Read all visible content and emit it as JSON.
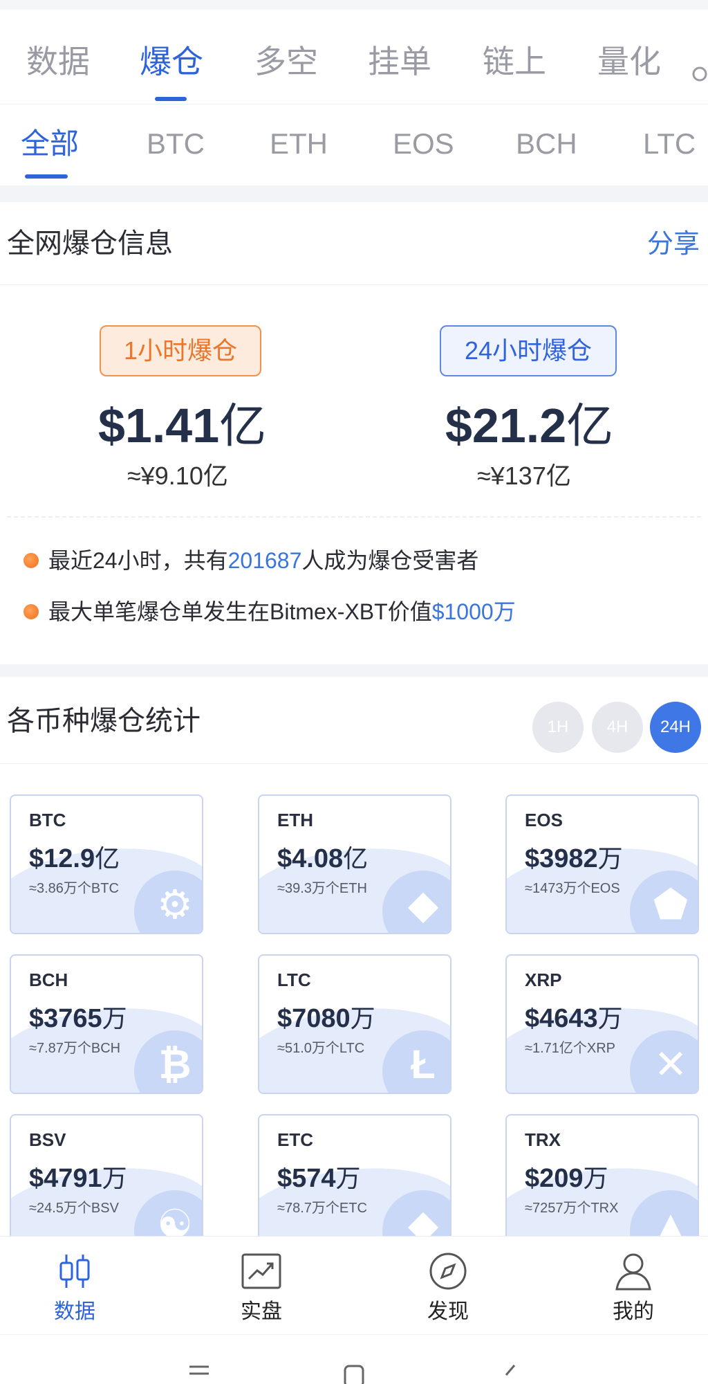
{
  "primary_tabs": [
    {
      "label": "数据"
    },
    {
      "label": "爆仓"
    },
    {
      "label": "多空"
    },
    {
      "label": "挂单"
    },
    {
      "label": "链上"
    },
    {
      "label": "量化"
    }
  ],
  "coin_tabs": [
    {
      "label": "全部"
    },
    {
      "label": "BTC"
    },
    {
      "label": "ETH"
    },
    {
      "label": "EOS"
    },
    {
      "label": "BCH"
    },
    {
      "label": "LTC"
    }
  ],
  "overview": {
    "title": "全网爆仓信息",
    "share_label": "分享",
    "one_hour": {
      "badge": "1小时爆仓",
      "amount": "$1.41",
      "unit": "亿",
      "cny": "≈¥9.10亿"
    },
    "day": {
      "badge": "24小时爆仓",
      "amount": "$21.2",
      "unit": "亿",
      "cny": "≈¥137亿"
    },
    "note1": {
      "prefix": "最近24小时，共有",
      "highlight": "201687",
      "suffix": "人成为爆仓受害者"
    },
    "note2": {
      "prefix": "最大单笔爆仓单发生在Bitmex-XBT价值",
      "highlight": "$1000万"
    }
  },
  "stats": {
    "title": "各币种爆仓统计",
    "periods": [
      {
        "label": "1H"
      },
      {
        "label": "4H"
      },
      {
        "label": "24H"
      }
    ],
    "active_period": "24H",
    "cards": [
      {
        "symbol": "BTC",
        "amount": "$12.9",
        "unit": "亿",
        "equiv": "≈3.86万个BTC",
        "icon": "bitcoin-icon"
      },
      {
        "symbol": "ETH",
        "amount": "$4.08",
        "unit": "亿",
        "equiv": "≈39.3万个ETH",
        "icon": "ethereum-icon"
      },
      {
        "symbol": "EOS",
        "amount": "$3982",
        "unit": "万",
        "equiv": "≈1473万个EOS",
        "icon": "eos-icon"
      },
      {
        "symbol": "BCH",
        "amount": "$3765",
        "unit": "万",
        "equiv": "≈7.87万个BCH",
        "icon": "bitcoin-cash-icon"
      },
      {
        "symbol": "LTC",
        "amount": "$7080",
        "unit": "万",
        "equiv": "≈51.0万个LTC",
        "icon": "litecoin-icon"
      },
      {
        "symbol": "XRP",
        "amount": "$4643",
        "unit": "万",
        "equiv": "≈1.71亿个XRP",
        "icon": "ripple-icon"
      },
      {
        "symbol": "BSV",
        "amount": "$4791",
        "unit": "万",
        "equiv": "≈24.5万个BSV",
        "icon": "bsv-icon"
      },
      {
        "symbol": "ETC",
        "amount": "$574",
        "unit": "万",
        "equiv": "≈78.7万个ETC",
        "icon": "etc-icon"
      },
      {
        "symbol": "TRX",
        "amount": "$209",
        "unit": "万",
        "equiv": "≈7257万个TRX",
        "icon": "tron-icon"
      }
    ]
  },
  "bottom_nav": [
    {
      "label": "数据",
      "icon": "candlestick-icon"
    },
    {
      "label": "实盘",
      "icon": "trend-chart-icon"
    },
    {
      "label": "发现",
      "icon": "compass-icon"
    },
    {
      "label": "我的",
      "icon": "user-icon"
    }
  ],
  "colors": {
    "accent": "#2f63dc",
    "orange": "#f06e16",
    "card_border": "#c8d4f0"
  }
}
